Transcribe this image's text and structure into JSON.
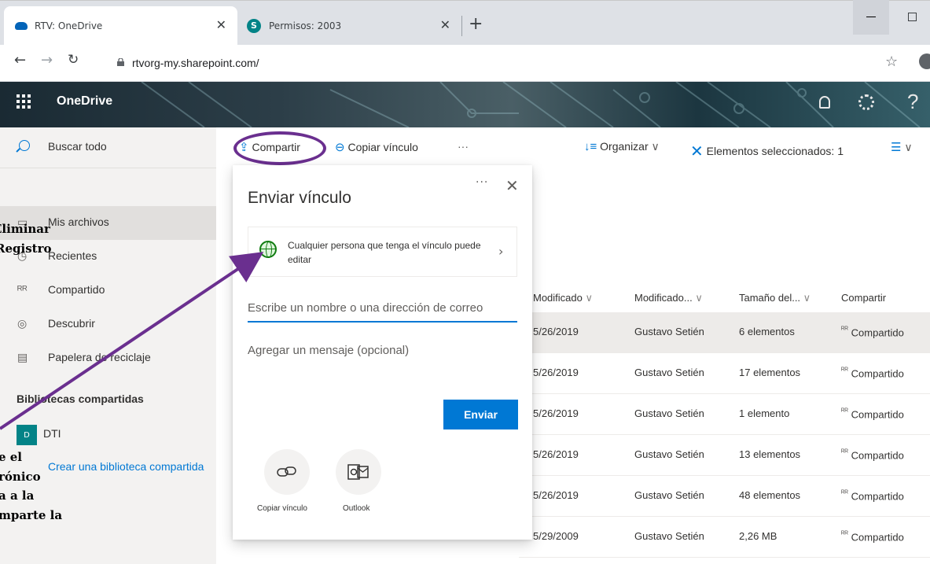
{
  "browser": {
    "tabs": [
      {
        "title": "RTV: OneDrive",
        "icon": "onedrive-icon"
      },
      {
        "title": "Permisos: 2003",
        "icon": "sharepoint-icon"
      }
    ],
    "url": "rtvorg-my.sharepoint.com/"
  },
  "suite": {
    "app_name": "OneDrive"
  },
  "sidebar": {
    "search_label": "Buscar todo",
    "items": [
      {
        "label": "Mis archivos",
        "icon": "folder-icon"
      },
      {
        "label": "Recientes",
        "icon": "clock-icon"
      },
      {
        "label": "Compartido",
        "icon": "people-icon"
      },
      {
        "label": "Descubrir",
        "icon": "discover-icon"
      },
      {
        "label": "Papelera de reciclaje",
        "icon": "trash-icon"
      }
    ],
    "libraries_header": "Bibliotecas compartidas",
    "libraries": [
      {
        "badge": "D",
        "label": "DTI"
      }
    ],
    "create_library": "Crear una biblioteca compartida"
  },
  "annotations": {
    "top": [
      "Eliminar",
      "Registro"
    ],
    "bottom": [
      "e el",
      "rónico",
      "a a la",
      "mparte la"
    ]
  },
  "commandbar": {
    "share": "Compartir",
    "copy_link": "Copiar vínculo",
    "more": "···",
    "sort": "Organizar",
    "selected": "Elementos seleccionados: 1"
  },
  "list": {
    "columns": [
      "Modificado",
      "Modificado...",
      "Tamaño del...",
      "Compartir"
    ],
    "rows": [
      {
        "modified": "5/26/2019",
        "by": "Gustavo Setién",
        "size": "6 elementos",
        "sharing": "Compartido"
      },
      {
        "modified": "5/26/2019",
        "by": "Gustavo Setién",
        "size": "17 elementos",
        "sharing": "Compartido"
      },
      {
        "modified": "5/26/2019",
        "by": "Gustavo Setién",
        "size": "1 elemento",
        "sharing": "Compartido"
      },
      {
        "modified": "5/26/2019",
        "by": "Gustavo Setién",
        "size": "13 elementos",
        "sharing": "Compartido"
      },
      {
        "modified": "5/26/2019",
        "by": "Gustavo Setién",
        "size": "48 elementos",
        "sharing": "Compartido"
      },
      {
        "modified": "5/29/2009",
        "by": "Gustavo Setién",
        "size": "2,26 MB",
        "sharing": "Compartido"
      }
    ]
  },
  "dialog": {
    "title": "Enviar vínculo",
    "permission": "Cualquier persona que tenga el vínculo puede editar",
    "email_placeholder": "Escribe un nombre o una dirección de correo",
    "message_placeholder": "Agregar un mensaje (opcional)",
    "send": "Enviar",
    "options": [
      {
        "label": "Copiar vínculo",
        "icon": "link-icon"
      },
      {
        "label": "Outlook",
        "icon": "outlook-icon"
      }
    ]
  },
  "colors": {
    "accent": "#0078d4",
    "annotation": "#6a2f8f",
    "library_badge": "#038387"
  }
}
